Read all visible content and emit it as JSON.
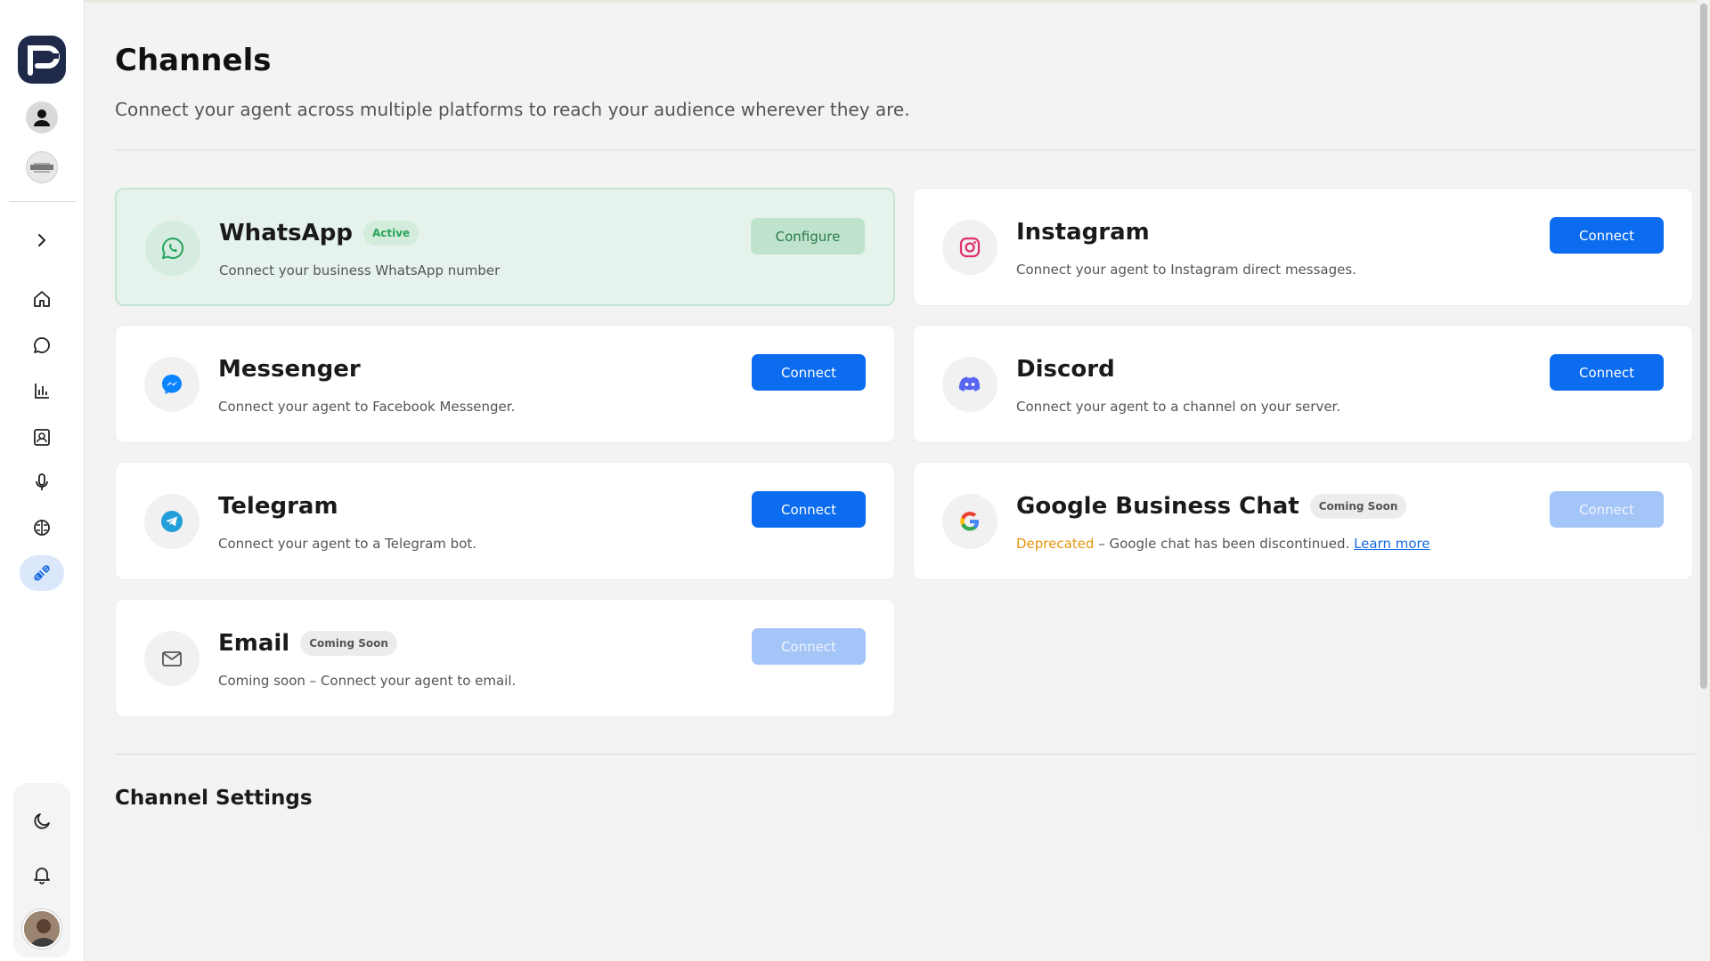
{
  "page": {
    "title": "Channels",
    "subtitle": "Connect your agent across multiple platforms to reach your audience wherever they are."
  },
  "sidebar": {
    "items": [
      {
        "name": "expand",
        "icon": "chevron-right-icon"
      },
      {
        "name": "home",
        "icon": "home-icon"
      },
      {
        "name": "chat",
        "icon": "chat-bubble-icon"
      },
      {
        "name": "analytics",
        "icon": "bar-chart-icon"
      },
      {
        "name": "contacts",
        "icon": "contact-card-icon"
      },
      {
        "name": "voice",
        "icon": "microphone-icon"
      },
      {
        "name": "knowledge",
        "icon": "brain-icon"
      },
      {
        "name": "channels",
        "icon": "plug-icon",
        "active": true
      }
    ],
    "bottom": [
      {
        "name": "theme",
        "icon": "moon-icon"
      },
      {
        "name": "notifications",
        "icon": "bell-icon"
      }
    ]
  },
  "channels": {
    "whatsapp": {
      "title": "WhatsApp",
      "badge": "Active",
      "description": "Connect your business WhatsApp number",
      "button": "Configure",
      "icon": "whatsapp-icon",
      "color": "#25a35a"
    },
    "instagram": {
      "title": "Instagram",
      "description": "Connect your agent to Instagram direct messages.",
      "button": "Connect",
      "icon": "instagram-icon",
      "color": "#e1306c"
    },
    "messenger": {
      "title": "Messenger",
      "description": "Connect your agent to Facebook Messenger.",
      "button": "Connect",
      "icon": "messenger-icon",
      "color": "#0a84ff"
    },
    "discord": {
      "title": "Discord",
      "description": "Connect your agent to a channel on your server.",
      "button": "Connect",
      "icon": "discord-icon",
      "color": "#5865f2"
    },
    "telegram": {
      "title": "Telegram",
      "description": "Connect your agent to a Telegram bot.",
      "button": "Connect",
      "icon": "telegram-icon",
      "color": "#229ed9"
    },
    "google": {
      "title": "Google Business Chat",
      "badge": "Coming Soon",
      "deprecated_label": "Deprecated",
      "description": " – Google chat has been discontinued. ",
      "learn_more": "Learn more",
      "button": "Connect",
      "icon": "google-icon",
      "color": "#4285f4"
    },
    "email": {
      "title": "Email",
      "badge": "Coming Soon",
      "description": "Coming soon – Connect your agent to email.",
      "button": "Connect",
      "icon": "mail-icon",
      "color": "#666666"
    }
  },
  "settings": {
    "title": "Channel Settings"
  }
}
